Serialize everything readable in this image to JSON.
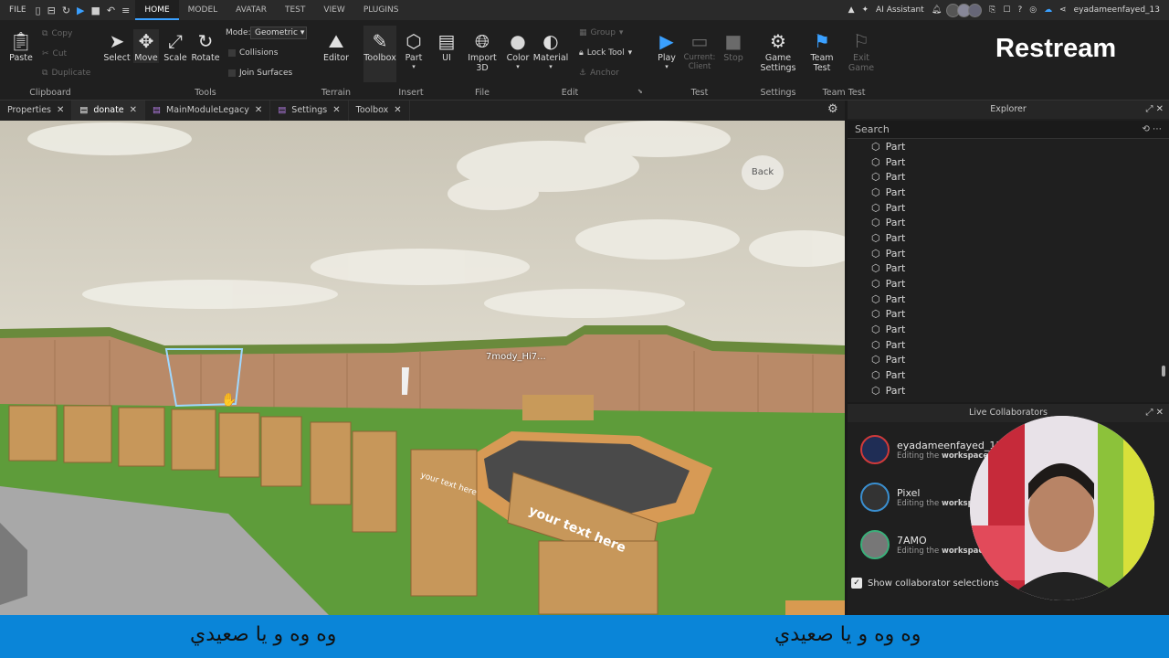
{
  "topbar": {
    "file": "FILE",
    "menu_tabs": [
      "HOME",
      "MODEL",
      "AVATAR",
      "TEST",
      "VIEW",
      "PLUGINS"
    ],
    "ai_assistant": "AI Assistant",
    "username": "eyadameenfayed_13"
  },
  "ribbon": {
    "clipboard": {
      "paste": "Paste",
      "copy": "Copy",
      "cut": "Cut",
      "duplicate": "Duplicate",
      "label": "Clipboard"
    },
    "tools": {
      "select": "Select",
      "move": "Move",
      "scale": "Scale",
      "rotate": "Rotate",
      "mode_label": "Mode:",
      "mode_value": "Geometric",
      "collisions": "Collisions",
      "join_surfaces": "Join Surfaces",
      "label": "Tools"
    },
    "terrain": {
      "editor": "Editor",
      "label": "Terrain"
    },
    "insert": {
      "toolbox": "Toolbox",
      "part": "Part",
      "ui": "UI",
      "label": "Insert"
    },
    "file": {
      "import3d_line1": "Import",
      "import3d_line2": "3D",
      "label": "File"
    },
    "edit": {
      "color": "Color",
      "material": "Material",
      "group": "Group",
      "lock_tool": "Lock Tool",
      "anchor": "Anchor",
      "label": "Edit"
    },
    "test": {
      "play": "Play",
      "current_client_1": "Current:",
      "current_client_2": "Client",
      "stop": "Stop",
      "label": "Test"
    },
    "settings": {
      "game_settings_1": "Game",
      "game_settings_2": "Settings",
      "label": "Settings"
    },
    "team_test": {
      "team_test_1": "Team",
      "team_test_2": "Test",
      "exit_game_1": "Exit",
      "exit_game_2": "Game",
      "label": "Team Test"
    }
  },
  "overlay": {
    "restream": "Restream"
  },
  "doc_tabs": [
    "Properties",
    "donate",
    "MainModuleLegacy",
    "Settings",
    "Toolbox"
  ],
  "viewport": {
    "player_label": "7mody_Hi7...",
    "back_button": "Back",
    "sign_text": "your text here"
  },
  "explorer": {
    "title": "Explorer",
    "search_placeholder": "Search",
    "items": [
      "Part",
      "Part",
      "Part",
      "Part",
      "Part",
      "Part",
      "Part",
      "Part",
      "Part",
      "Part",
      "Part",
      "Part",
      "Part",
      "Part",
      "Part",
      "Part",
      "Part"
    ]
  },
  "collaborators": {
    "title": "Live Collaborators",
    "editing_prefix": "Editing the",
    "workspace": "workspace",
    "people": [
      {
        "name": "eyadameenfayed_13",
        "ring": "#d03a3a"
      },
      {
        "name": "Pixel",
        "ring": "#3a8fd0"
      },
      {
        "name": "7AMO",
        "ring": "#3ab07a"
      }
    ],
    "show_selections": "Show collaborator selections"
  },
  "subtitles": {
    "left": "وه وه و يا صعيدي",
    "right": "وه وه و يا صعيدي"
  },
  "colors": {
    "accent": "#3aa0ff",
    "subtitle_bar": "#0a85d8"
  }
}
